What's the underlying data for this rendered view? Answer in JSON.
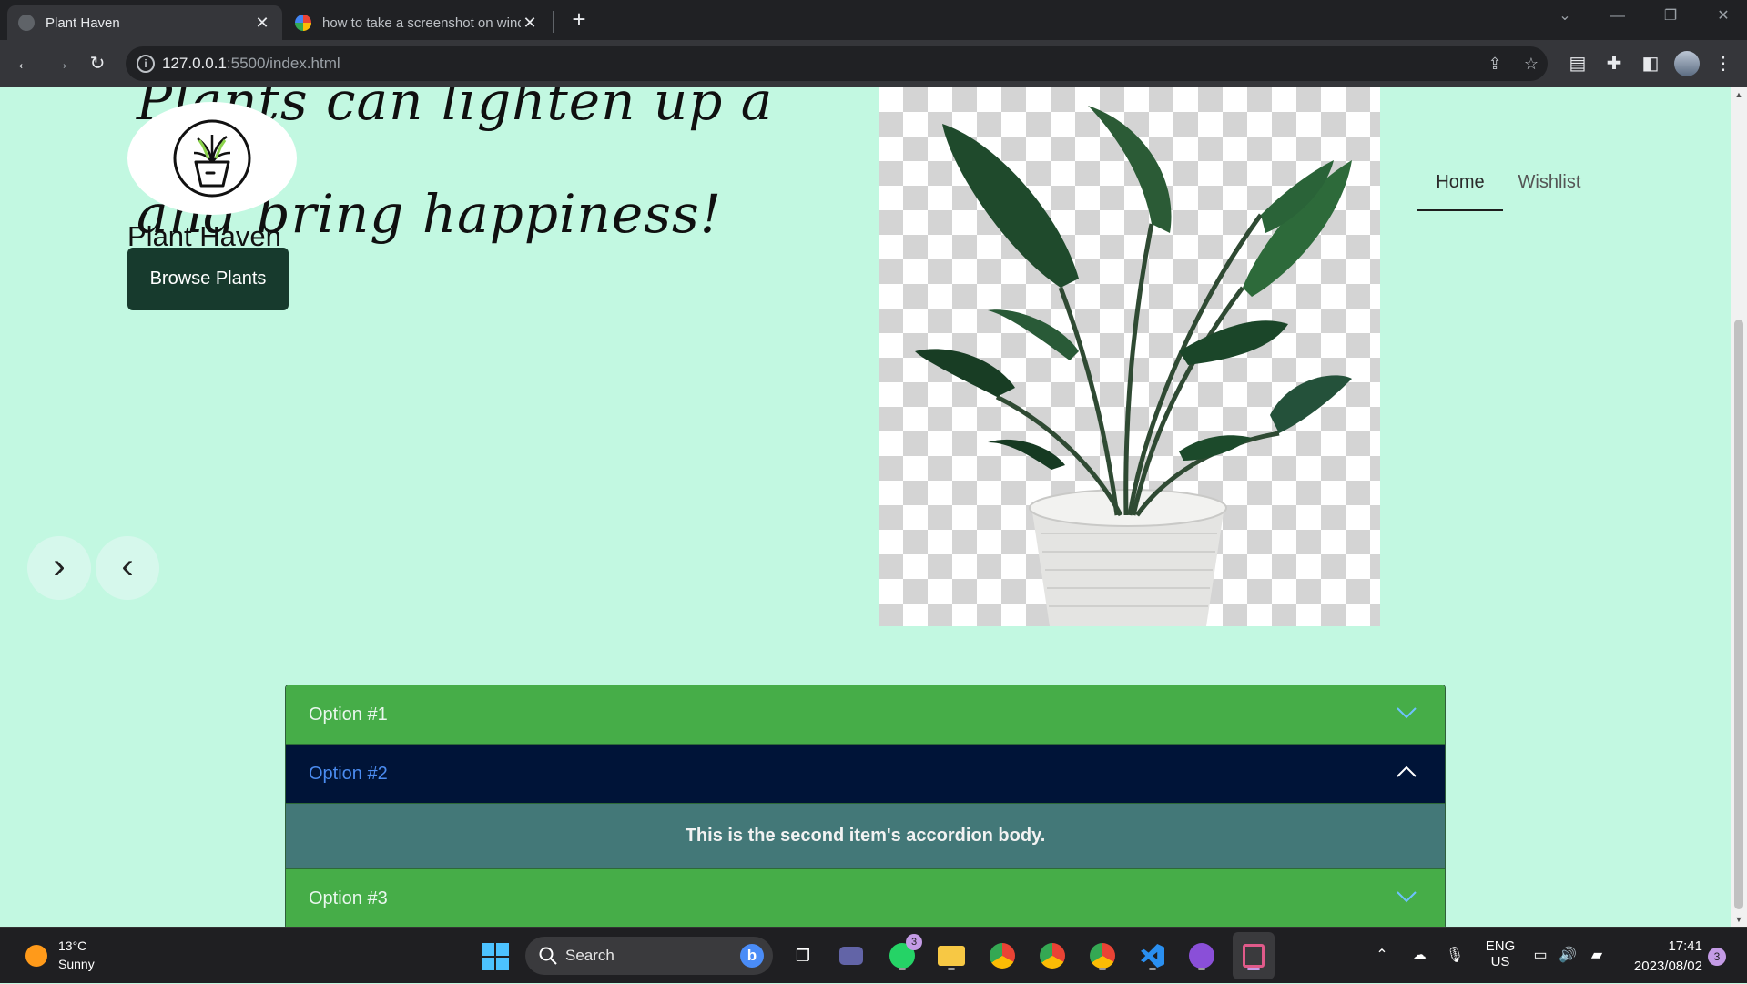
{
  "browser": {
    "tabs": [
      {
        "title": "Plant Haven",
        "active": true
      },
      {
        "title": "how to take a screenshot on windows",
        "active": false
      }
    ],
    "new_tab_label": "+",
    "url_host": "127.0.0.1",
    "url_path": ":5500/index.html"
  },
  "page": {
    "hero_line1": "Plants can lighten up a room",
    "hero_line2": "and bring happiness!",
    "brand": "Plant Haven",
    "browse_button": "Browse Plants",
    "nav": {
      "home": "Home",
      "wishlist": "Wishlist"
    },
    "carousel": {
      "next": "›",
      "prev": "‹"
    },
    "accordion": {
      "option1": "Option #1",
      "option2": "Option #2",
      "option2_body": "This is the second item's accordion body.",
      "option3": "Option #3"
    },
    "colors": {
      "page_bg": "#c2f8e1",
      "accent_green": "#46ad48",
      "open_header": "#001438",
      "body_teal": "#437878",
      "button_dark": "#173a2d"
    }
  },
  "taskbar": {
    "weather_temp": "13°C",
    "weather_cond": "Sunny",
    "search_label": "Search",
    "whatsapp_badge": "3",
    "lang_line1": "ENG",
    "lang_line2": "US",
    "time": "17:41",
    "date": "2023/08/02",
    "notifications": "3"
  }
}
